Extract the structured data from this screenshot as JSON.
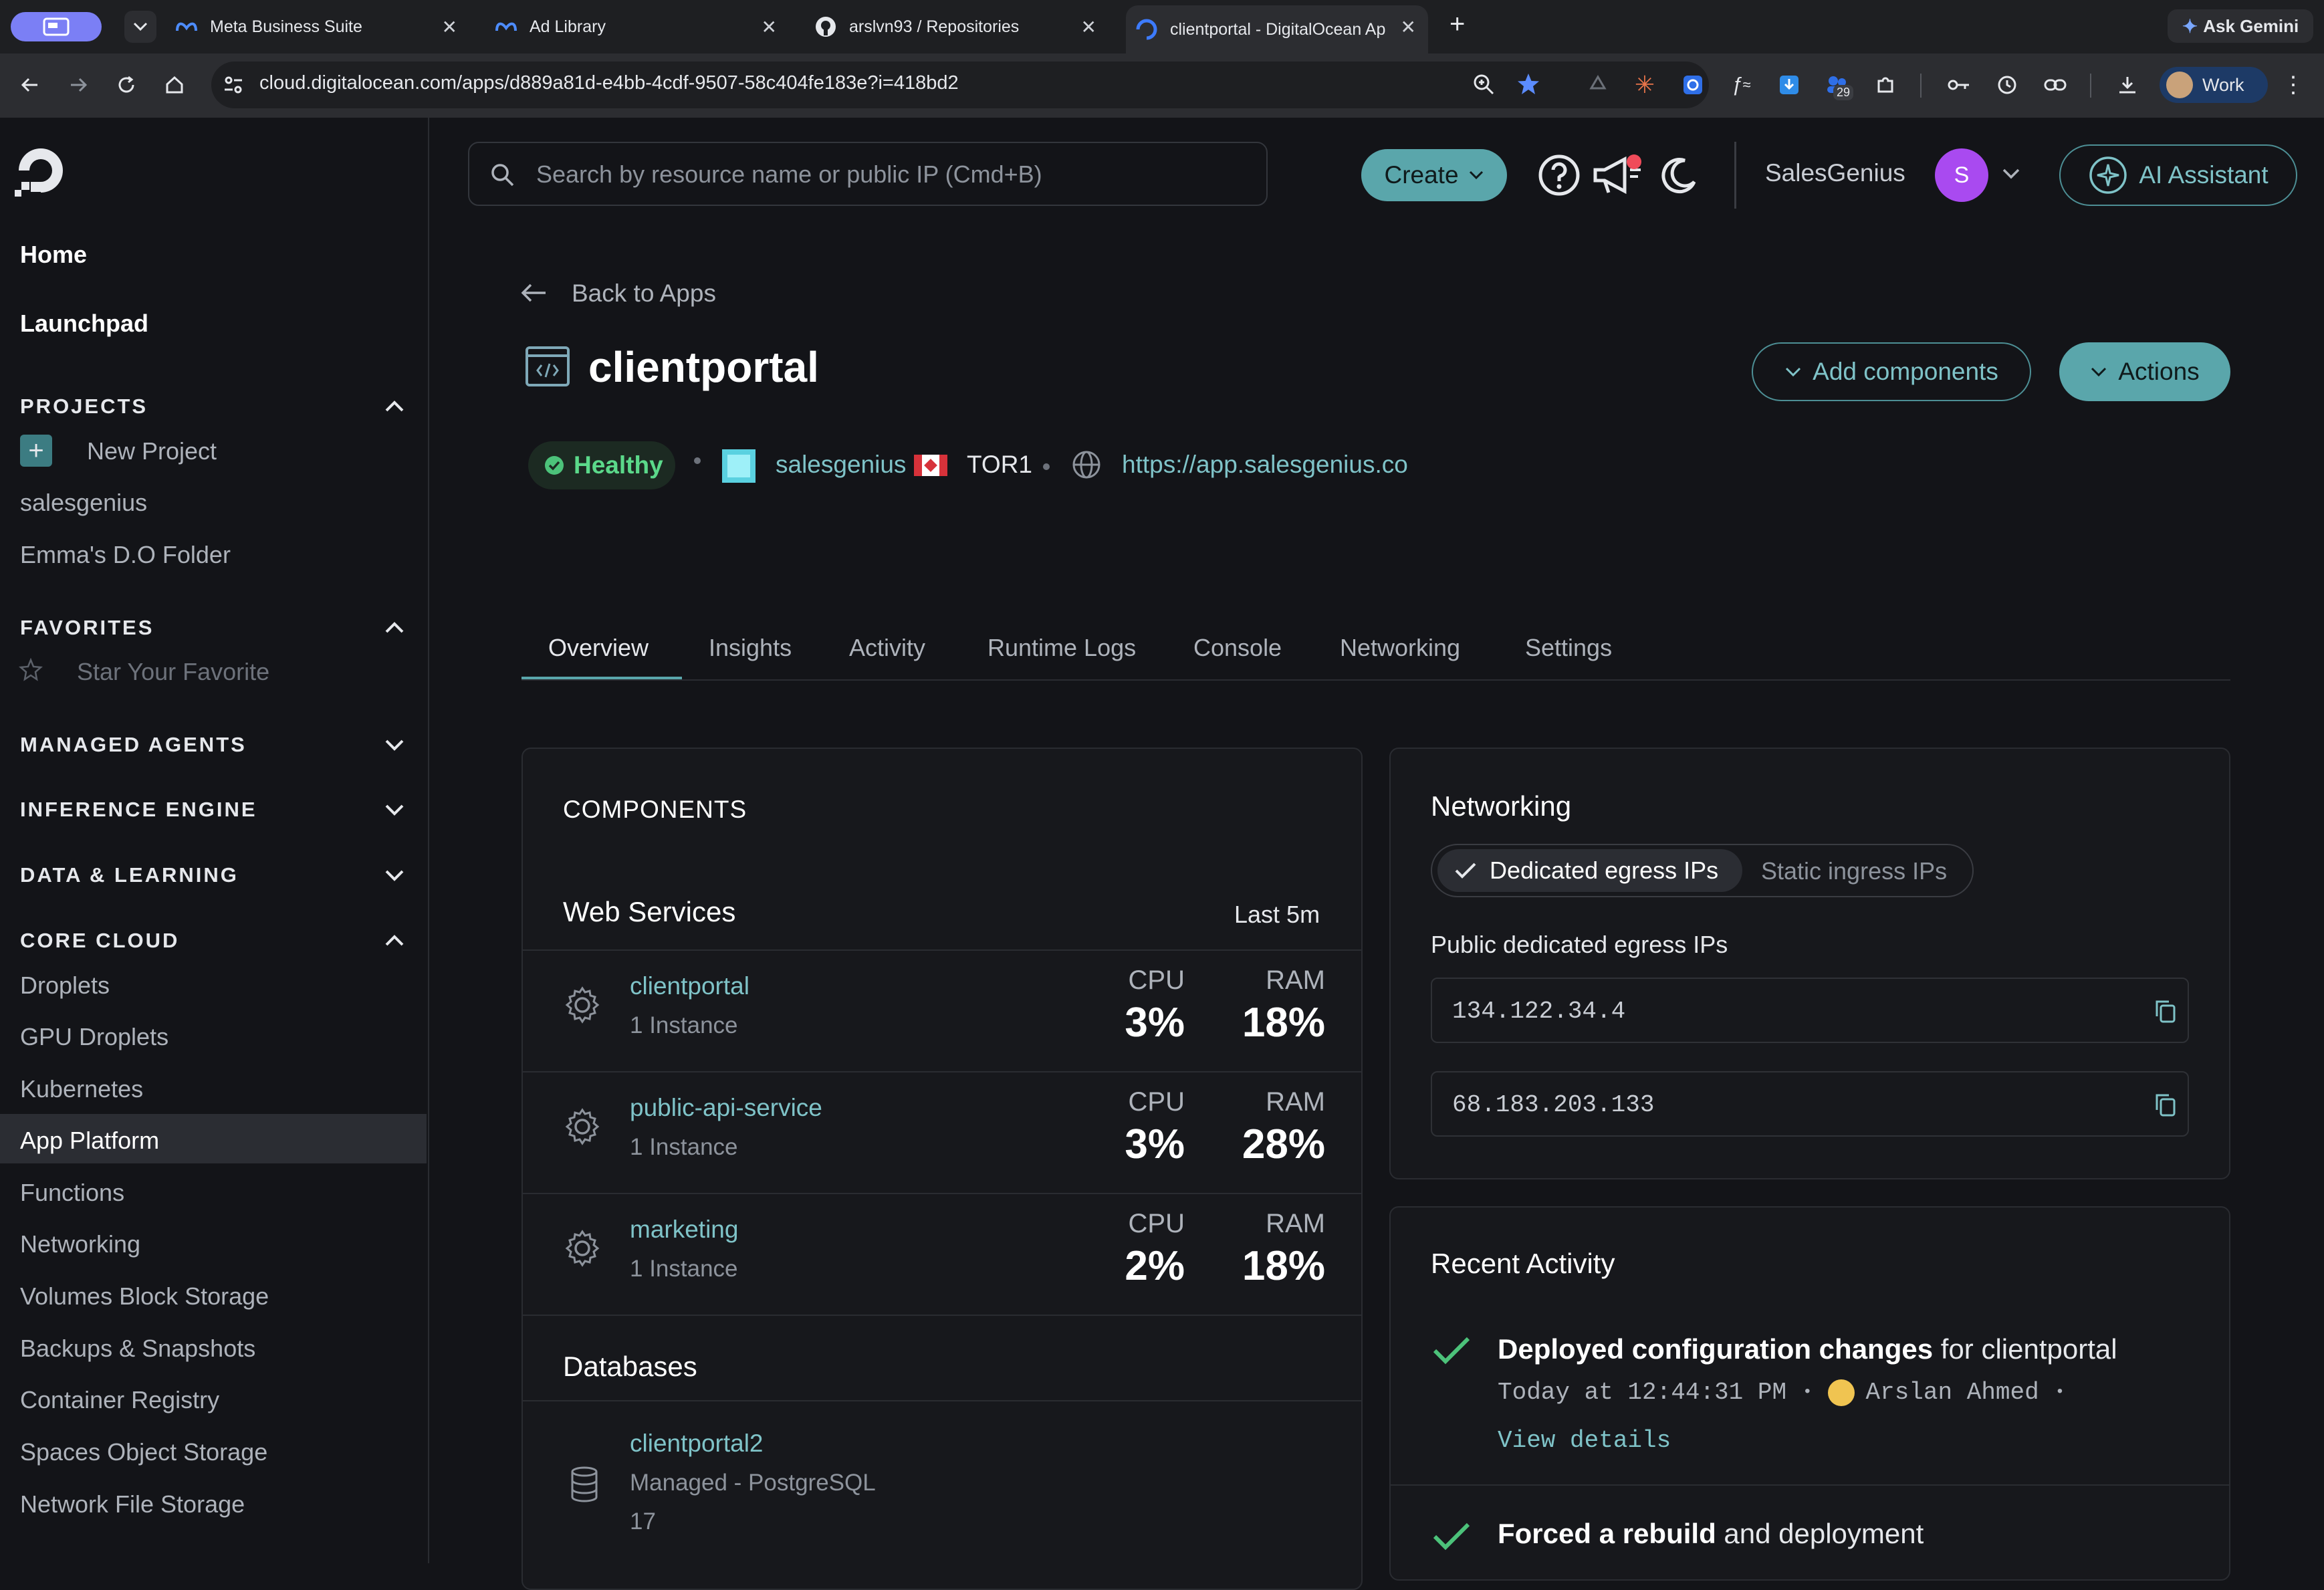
{
  "browser": {
    "tabs": [
      {
        "title": "Meta Business Suite"
      },
      {
        "title": "Ad Library"
      },
      {
        "title": "arslvn93 / Repositories"
      },
      {
        "title": "clientportal - DigitalOcean Ap"
      }
    ],
    "new_tab": "+",
    "ask_gemini": "Ask Gemini",
    "url": "cloud.digitalocean.com/apps/d889a81d-e4bb-4cdf-9507-58c404fe183e?i=418bd2",
    "extension_badge": "29",
    "profile_label": "Work"
  },
  "sidebar": {
    "top_items": [
      {
        "label": "Home"
      },
      {
        "label": "Launchpad"
      }
    ],
    "projects": {
      "heading": "PROJECTS",
      "new_project": "New Project",
      "items": [
        {
          "label": "salesgenius"
        },
        {
          "label": "Emma's D.O Folder"
        }
      ]
    },
    "favorites": {
      "heading": "FAVORITES",
      "placeholder": "Star Your Favorite"
    },
    "sections": [
      {
        "heading": "MANAGED AGENTS"
      },
      {
        "heading": "INFERENCE ENGINE"
      },
      {
        "heading": "DATA & LEARNING"
      }
    ],
    "core_cloud": {
      "heading": "CORE CLOUD",
      "items": [
        {
          "label": "Droplets"
        },
        {
          "label": "GPU Droplets"
        },
        {
          "label": "Kubernetes"
        },
        {
          "label": "App Platform"
        },
        {
          "label": "Functions"
        },
        {
          "label": "Networking"
        },
        {
          "label": "Volumes Block Storage"
        },
        {
          "label": "Backups & Snapshots"
        },
        {
          "label": "Container Registry"
        },
        {
          "label": "Spaces Object Storage"
        },
        {
          "label": "Network File Storage"
        }
      ],
      "active": "App Platform"
    }
  },
  "topbar": {
    "search_placeholder": "Search by resource name or public IP (Cmd+B)",
    "create_label": "Create",
    "team_name": "SalesGenius",
    "avatar_initial": "S",
    "ai_assistant_label": "AI Assistant",
    "colors": {
      "accent": "#5aa6ab",
      "avatar": "#a94af0"
    }
  },
  "app": {
    "back_label": "Back to Apps",
    "name": "clientportal",
    "add_components_label": "Add components",
    "actions_label": "Actions",
    "status": "Healthy",
    "project": "salesgenius",
    "region": "TOR1",
    "live_url": "https://app.salesgenius.co",
    "tabs": [
      {
        "label": "Overview"
      },
      {
        "label": "Insights"
      },
      {
        "label": "Activity"
      },
      {
        "label": "Runtime Logs"
      },
      {
        "label": "Console"
      },
      {
        "label": "Networking"
      },
      {
        "label": "Settings"
      }
    ],
    "active_tab": "Overview"
  },
  "components": {
    "title": "COMPONENTS",
    "web_services_label": "Web Services",
    "window_label": "Last 5m",
    "cpu_label": "CPU",
    "ram_label": "RAM",
    "services": [
      {
        "name": "clientportal",
        "instances": "1 Instance",
        "cpu": "3%",
        "ram": "18%"
      },
      {
        "name": "public-api-service",
        "instances": "1 Instance",
        "cpu": "3%",
        "ram": "28%"
      },
      {
        "name": "marketing",
        "instances": "1 Instance",
        "cpu": "2%",
        "ram": "18%"
      }
    ],
    "databases_label": "Databases",
    "databases": [
      {
        "name": "clientportal2",
        "engine": "Managed - PostgreSQL",
        "version": "17"
      }
    ]
  },
  "networking": {
    "title": "Networking",
    "toggle": {
      "selected": "Dedicated egress IPs",
      "other": "Static ingress IPs"
    },
    "ips_label": "Public dedicated egress IPs",
    "ips": [
      "134.122.34.4",
      "68.183.203.133"
    ]
  },
  "recent_activity": {
    "title": "Recent Activity",
    "items": [
      {
        "action": "Deployed configuration changes",
        "suffix": "for clientportal",
        "time": "Today at 12:44:31 PM",
        "user": "Arslan Ahmed",
        "details_label": "View details"
      },
      {
        "action": "Forced a rebuild",
        "suffix": "and deployment"
      }
    ]
  }
}
